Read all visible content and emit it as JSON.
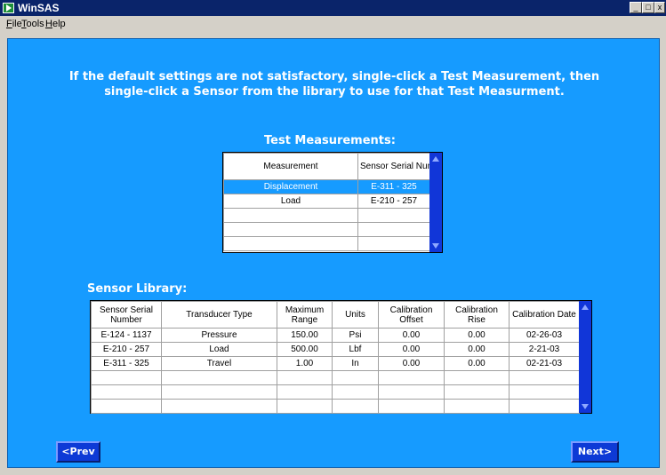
{
  "window": {
    "title": "WinSAS"
  },
  "menu": [
    {
      "mnemonic": "F",
      "rest": "ile"
    },
    {
      "mnemonic": "T",
      "rest": "ools"
    },
    {
      "mnemonic": "H",
      "rest": "elp"
    }
  ],
  "instructions": {
    "line1": "If the default settings are not satisfactory,  single-click a Test Measurement, then",
    "line2": "single-click a Sensor from the library to use for that Test Measurment."
  },
  "test_measurements": {
    "title": "Test Measurements:",
    "columns": [
      "Measurement",
      "Sensor Serial Number"
    ],
    "rows": [
      [
        "Displacement",
        "E-311 - 325"
      ],
      [
        "Load",
        "E-210 - 257"
      ],
      [
        "",
        ""
      ],
      [
        "",
        ""
      ],
      [
        "",
        ""
      ]
    ],
    "selected_row": 0
  },
  "sensor_library": {
    "title": "Sensor Library:",
    "columns": [
      "Sensor Serial Number",
      "Transducer Type",
      "Maximum Range",
      "Units",
      "Calibration Offset",
      "Calibration Rise",
      "Calibration Date"
    ],
    "rows": [
      [
        "E-124 - 1137",
        "Pressure",
        "150.00",
        "Psi",
        "0.00",
        "0.00",
        "02-26-03"
      ],
      [
        "E-210 - 257",
        "Load",
        "500.00",
        "Lbf",
        "0.00",
        "0.00",
        "2-21-03"
      ],
      [
        "E-311 - 325",
        "Travel",
        "1.00",
        "In",
        "0.00",
        "0.00",
        "02-21-03"
      ],
      [
        "",
        "",
        "",
        "",
        "",
        "",
        ""
      ],
      [
        "",
        "",
        "",
        "",
        "",
        "",
        ""
      ],
      [
        "",
        "",
        "",
        "",
        "",
        "",
        ""
      ]
    ]
  },
  "buttons": {
    "prev": "<Prev",
    "next": "Next>"
  },
  "colors": {
    "panel": "#169bff",
    "titlebar": "#0a246a",
    "scrollbar": "#1136d8",
    "nav_button": "#0d3ad6"
  }
}
